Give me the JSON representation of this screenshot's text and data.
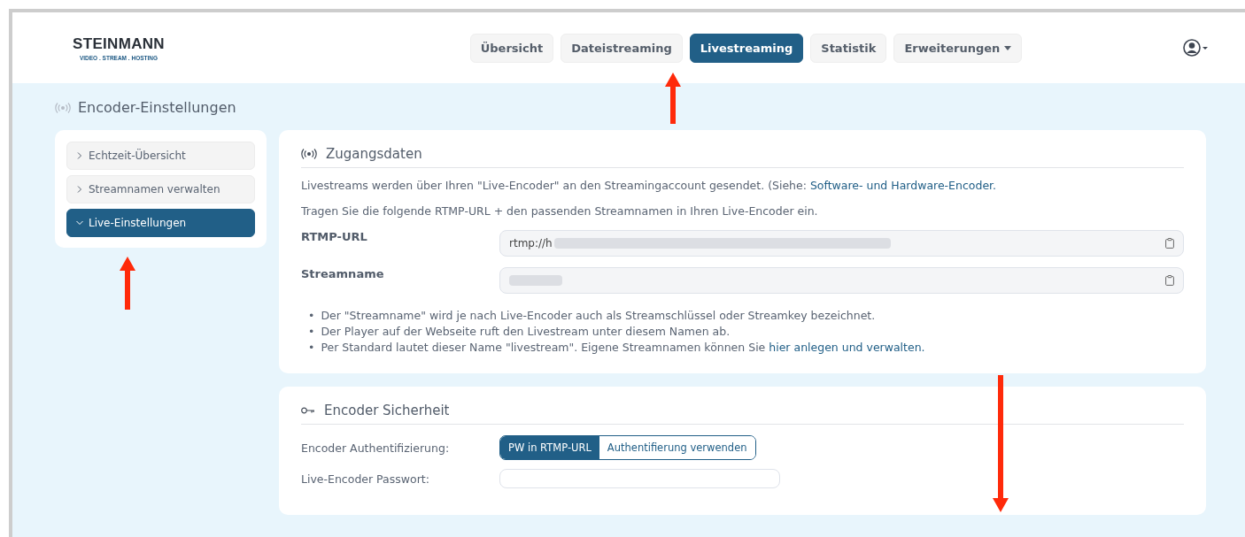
{
  "logo": {
    "name": "STEINMANN",
    "tagline": "VIDEO . STREAM . HOSTING"
  },
  "nav": [
    {
      "label": "Übersicht",
      "selected": false,
      "dropdown": false
    },
    {
      "label": "Dateistreaming",
      "selected": false,
      "dropdown": false
    },
    {
      "label": "Livestreaming",
      "selected": true,
      "dropdown": false
    },
    {
      "label": "Statistik",
      "selected": false,
      "dropdown": false
    },
    {
      "label": "Erweiterungen",
      "selected": false,
      "dropdown": true
    }
  ],
  "page_title": "Encoder-Einstellungen",
  "sidebar": {
    "items": [
      {
        "label": "Echtzeit-Übersicht",
        "selected": false,
        "expanded": false
      },
      {
        "label": "Streamnamen verwalten",
        "selected": false,
        "expanded": false
      },
      {
        "label": "Live-Einstellungen",
        "selected": true,
        "expanded": true
      }
    ]
  },
  "access": {
    "title": "Zugangsdaten",
    "intro": {
      "text": "Livestreams werden über Ihren \"Live-Encoder\" an den Streamingaccount gesendet. (Siehe: ",
      "link": "Software- und Hardware-Encoder."
    },
    "instruction": "Tragen Sie die folgende RTMP-URL + den passenden Streamnamen in Ihren Live-Encoder ein.",
    "fields": [
      {
        "label": "RTMP-URL",
        "value": "rtmp://h"
      },
      {
        "label": "Streamname"
      }
    ],
    "notes": [
      {
        "marker": "•",
        "text": "Der \"Streamname\" wird je nach Live-Encoder auch als Streamschlüssel oder Streamkey bezeichnet."
      },
      {
        "marker": "•",
        "text": "Der Player auf der Webseite ruft den Livestream unter diesem Namen ab."
      },
      {
        "marker": "•",
        "text": "Per Standard lautet dieser Name \"livestream\". Eigene Streamnamen können Sie ",
        "link": "hier anlegen und verwalten."
      }
    ]
  },
  "security": {
    "title": "Encoder Sicherheit",
    "auth_label": "Encoder Authentifizierung:",
    "auth_options": [
      {
        "label": "PW in RTMP-URL",
        "selected": true
      },
      {
        "label": "Authentifierung verwenden",
        "selected": false
      }
    ],
    "password_label": "Live-Encoder Passwort:"
  }
}
